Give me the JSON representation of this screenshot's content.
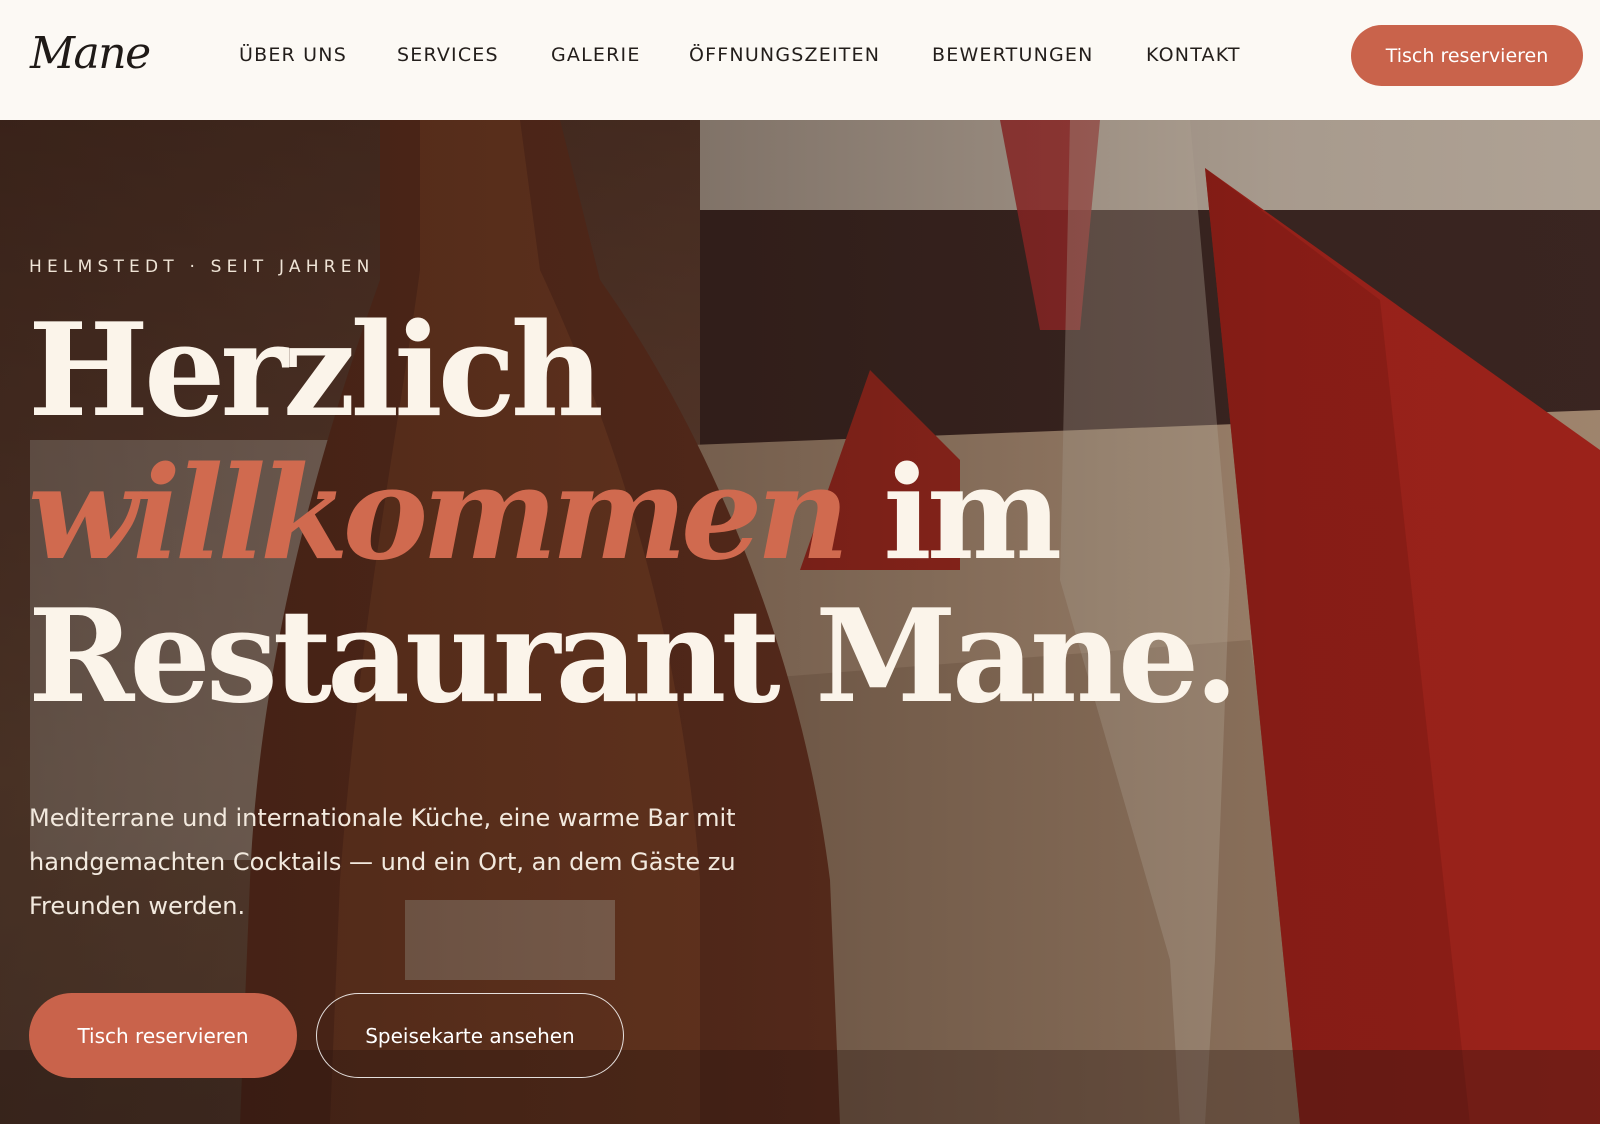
{
  "brand": {
    "logo_text": "Mane"
  },
  "nav": {
    "items": [
      {
        "label": "ÜBER UNS"
      },
      {
        "label": "SERVICES"
      },
      {
        "label": "GALERIE"
      },
      {
        "label": "ÖFFNUNGSZEITEN"
      },
      {
        "label": "BEWERTUNGEN"
      },
      {
        "label": "KONTAKT"
      }
    ],
    "cta_label": "Tisch reservieren"
  },
  "hero": {
    "eyebrow": "HELMSTEDT · SEIT JAHREN",
    "headline_line1": "Herzlich",
    "headline_accent": "willkommen",
    "headline_line2_rest": " im",
    "headline_line3": "Restaurant Mane.",
    "lead": "Mediterrane und internationale Küche, eine warme Bar mit handgemachten Cocktails — und ein Ort, an dem Gäste zu Freunden werden.",
    "primary_cta": "Tisch reservieren",
    "secondary_cta": "Speisekarte ansehen"
  },
  "colors": {
    "accent": "#c9634b",
    "header_bg": "#fcf9f4",
    "headline_text": "#fbf4ea"
  }
}
